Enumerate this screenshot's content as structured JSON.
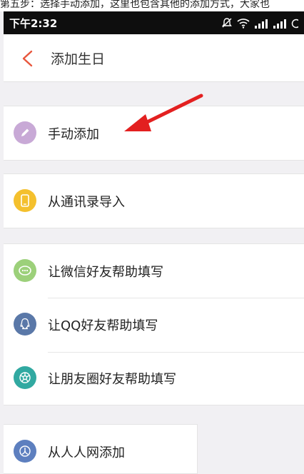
{
  "caption": "第五步：选择手动添加，这里也包含其他的添加方式，大家也",
  "status_bar": {
    "time": "下午2:32",
    "icons": [
      "mute-icon",
      "wifi-icon",
      "signal-icon",
      "signal-icon",
      "battery-icon"
    ]
  },
  "header": {
    "title": "添加生日"
  },
  "options": [
    {
      "label": "手动添加",
      "icon": "pencil-icon",
      "color": "#c8a9d6"
    },
    {
      "label": "从通讯录导入",
      "icon": "phone-icon",
      "color": "#f4c02d"
    },
    {
      "label": "让微信好友帮助填写",
      "icon": "wechat-icon",
      "color": "#9cd07a"
    },
    {
      "label": "让QQ好友帮助填写",
      "icon": "qq-icon",
      "color": "#5a78a8"
    },
    {
      "label": "让朋友圈好友帮助填写",
      "icon": "moments-icon",
      "color": "#31a9a1"
    },
    {
      "label": "从人人网添加",
      "icon": "renren-icon",
      "color": "#5d7fbf"
    }
  ],
  "colors": {
    "accent": "#e8563c",
    "annotation_arrow": "#e32020"
  }
}
